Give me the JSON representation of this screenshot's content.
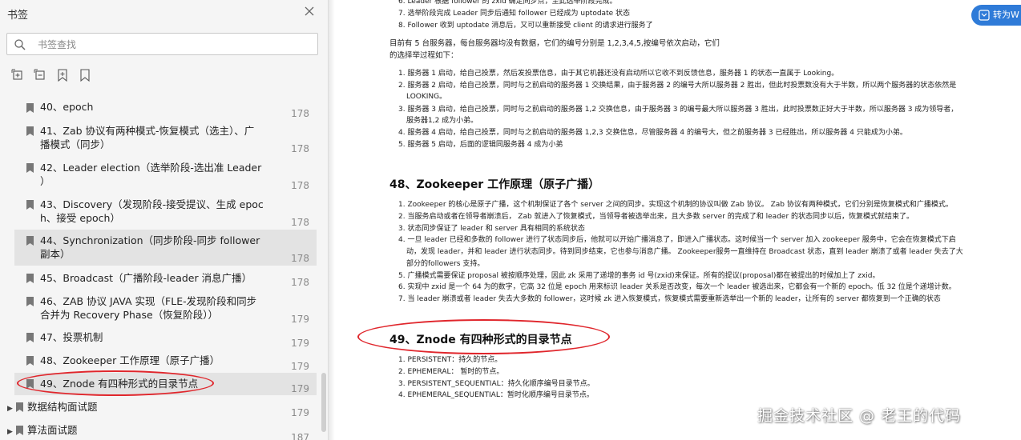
{
  "sidebar": {
    "title": "书签",
    "search_placeholder": "书签查找",
    "items": [
      {
        "lines": [
          "40、epoch"
        ],
        "page": "178"
      },
      {
        "lines": [
          "41、Zab 协议有两种模式-恢复模式（选主）、广",
          "播模式（同步）"
        ],
        "page": "178"
      },
      {
        "lines": [
          "42、Leader election（选举阶段-选出准 Leader",
          "）"
        ],
        "page": "178"
      },
      {
        "lines": [
          "43、Discovery（发现阶段-接受提议、生成 epoc",
          "h、接受 epoch）"
        ],
        "page": "178"
      },
      {
        "lines": [
          "44、Synchronization（同步阶段-同步 follower",
          "副本）"
        ],
        "page": "178"
      },
      {
        "lines": [
          "45、Broadcast（广播阶段-leader 消息广播）"
        ],
        "page": "178"
      },
      {
        "lines": [
          "46、ZAB 协议 JAVA 实现（FLE-发现阶段和同步",
          "合并为 Recovery Phase（恢复阶段））"
        ],
        "page": "179"
      },
      {
        "lines": [
          "47、投票机制"
        ],
        "page": "179"
      },
      {
        "lines": [
          "48、Zookeeper 工作原理（原子广播）"
        ],
        "page": "179"
      },
      {
        "lines": [
          "49、Znode 有四种形式的目录节点"
        ],
        "page": "179"
      }
    ],
    "top_items": [
      {
        "label": "数据结构面试题",
        "page": "179"
      },
      {
        "label": "算法面试题",
        "page": "187"
      }
    ]
  },
  "convert_button": {
    "label": "转为W"
  },
  "document": {
    "top_list": [
      "6. Leader 根据 follower 的 zxid 确定同步点，至此选举阶段完成。",
      "7. 选举阶段完成 Leader 同步后通知 follower 已经成为 uptodate 状态",
      "8. Follower 收到 uptodate 消息后，又可以重新接受 client 的请求进行服务了"
    ],
    "para": [
      "目前有 5 台服务器，每台服务器均没有数据，它们的编号分别是 1,2,3,4,5,按编号依次启动，它们",
      "的选择举过程如下："
    ],
    "server_list": [
      "1. 服务器 1 启动，给自己投票，然后发投票信息，由于其它机器还没有启动所以它收不到反馈信息，服务器 1 的状态一直属于 Looking。",
      "2. 服务器 2 启动，给自己投票，同时与之前启动的服务器 1 交换结果，由于服务器 2 的编号大所以服务器 2 胜出，但此时投票数没有大于半数，所以两个服务器的状态依然是",
      "LOOKING。",
      "3. 服务器 3 启动，给自己投票，同时与之前启动的服务器 1,2 交换信息，由于服务器 3 的编号最大所以服务器 3 胜出，此时投票数正好大于半数，所以服务器 3 成为领导者，",
      "服务器1,2 成为小弟。",
      "4. 服务器 4 启动，给自己投票，同时与之前启动的服务器 1,2,3 交换信息，尽管服务器 4 的编号大，但之前服务器 3 已经胜出，所以服务器 4 只能成为小弟。",
      "5. 服务器 5 启动，后面的逻辑同服务器 4 成为小弟"
    ],
    "heading48": "48、Zookeeper 工作原理（原子广播）",
    "list48": [
      "1. Zookeeper 的核心是原子广播，这个机制保证了各个 server 之间的同步。实现这个机制的协议叫做 Zab 协议。 Zab 协议有两种模式，它们分别是恢复模式和广播模式。",
      "2. 当服务启动或者在领导者崩溃后， Zab 就进入了恢复模式，当领导者被选举出来，且大多数 server 的完成了和 leader 的状态同步以后，恢复模式就结束了。",
      "3. 状态同步保证了 leader 和 server 具有相同的系统状态",
      "4. 一旦 leader 已经和多数的 follower 进行了状态同步后，他就可以开始广播消息了，即进入广播状态。这时候当一个 server 加入 zookeeper 服务中，它会在恢复模式下启",
      "动，发现 leader，并和 leader 进行状态同步。待到同步结束，它也参与消息广播。 Zookeeper服务一直维持在 Broadcast 状态，直到 leader 崩溃了或者 leader 失去了大",
      "部分的followers 支持。",
      "5. 广播模式需要保证 proposal 被按顺序处理，因此 zk 采用了递增的事务 id 号(zxid)来保证。所有的提议(proposal)都在被提出的时候加上了 zxid。",
      "6. 实现中 zxid 是一个 64 为的数字，它高 32 位是 epoch 用来标识 leader 关系是否改变，每次一个 leader 被选出来，它都会有一个新的 epoch。低 32 位是个递增计数。",
      "7. 当 leader 崩溃或者 leader 失去大多数的 follower，这时候 zk 进入恢复模式，恢复模式需要重新选举出一个新的 leader，让所有的 server 都恢复到一个正确的状态"
    ],
    "heading49": "49、Znode 有四种形式的目录节点",
    "list49": [
      "1. PERSISTENT：持久的节点。",
      "2. EPHEMERAL： 暂时的节点。",
      "3. PERSISTENT_SEQUENTIAL：持久化顺序编号目录节点。",
      "4. EPHEMERAL_SEQUENTIAL：暂时化顺序编号目录节点。"
    ]
  },
  "watermark": "掘金技术社区 @ 老王的代码",
  "colors": {
    "annotation": "#e0262c",
    "accent": "#2f7bd8",
    "sidebar_bg": "#f5f5f5",
    "highlight": "#e3e3e3"
  }
}
